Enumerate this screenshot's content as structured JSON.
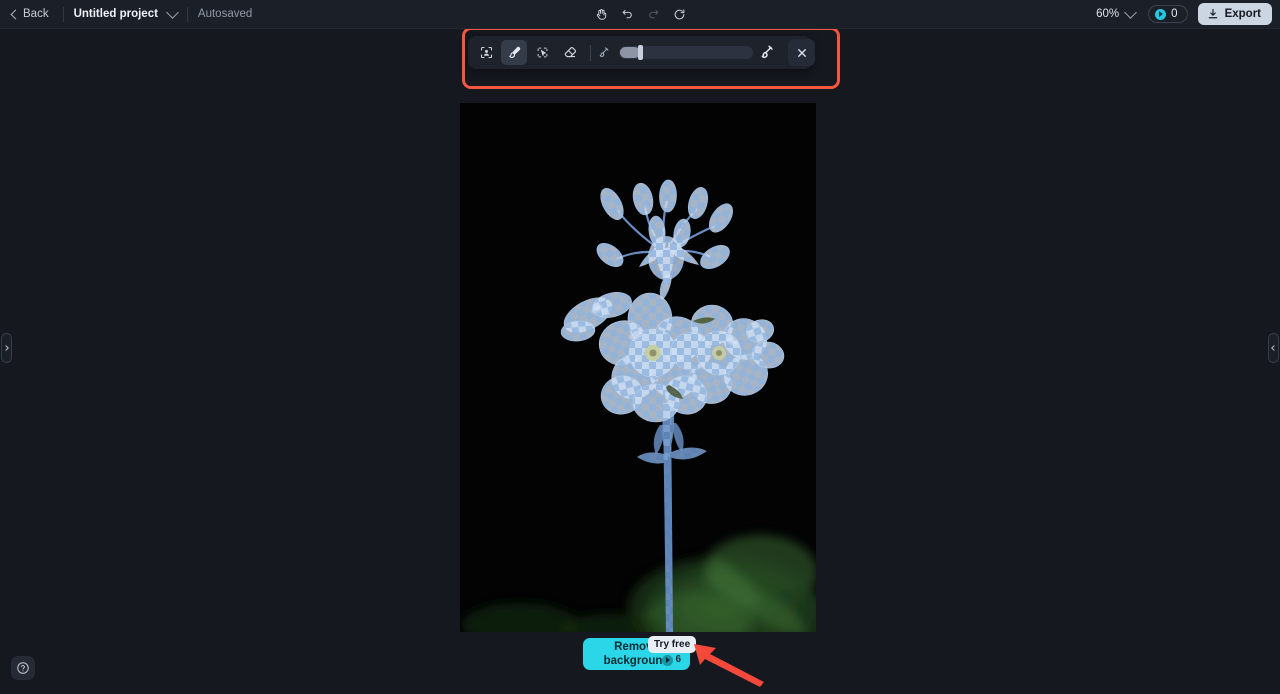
{
  "topbar": {
    "back_label": "Back",
    "project_name": "Untitled project",
    "save_status": "Autosaved",
    "zoom_level": "60%",
    "credits_count": "0",
    "export_label": "Export",
    "center_tools": [
      {
        "name": "hand-tool",
        "title": "Hand / pan tool",
        "disabled": false
      },
      {
        "name": "undo",
        "title": "Undo",
        "disabled": false
      },
      {
        "name": "redo",
        "title": "Redo",
        "disabled": true
      },
      {
        "name": "reset",
        "title": "Reset",
        "disabled": false
      }
    ]
  },
  "toolbar": {
    "tools": [
      {
        "name": "select-subject-tool",
        "label": "Select subject",
        "active": false
      },
      {
        "name": "brush-tool",
        "label": "Brush",
        "active": true
      },
      {
        "name": "magic-select-tool",
        "label": "Magic select",
        "active": false
      },
      {
        "name": "eraser-tool",
        "label": "Eraser",
        "active": false
      }
    ],
    "brush_size_label": "Brush size",
    "brush_size_value": "14",
    "close_label": "Close"
  },
  "canvas": {
    "image_alt": "Blue-tinted flowering plant on black background with checkerboard selection mask"
  },
  "cta": {
    "label_line1": "Remove",
    "label_line2": "background",
    "cost": "6",
    "badge": "Try free"
  },
  "panels": {
    "left_handle_label": "Expand left panel",
    "right_handle_label": "Expand right panel"
  },
  "help": {
    "label": "Help"
  },
  "colors": {
    "accent_cyan": "#2ad6e8",
    "annotation_red": "#f4573f",
    "background": "#15181f",
    "topbar": "#1b1f28",
    "export_bg": "#ccd5e2"
  }
}
